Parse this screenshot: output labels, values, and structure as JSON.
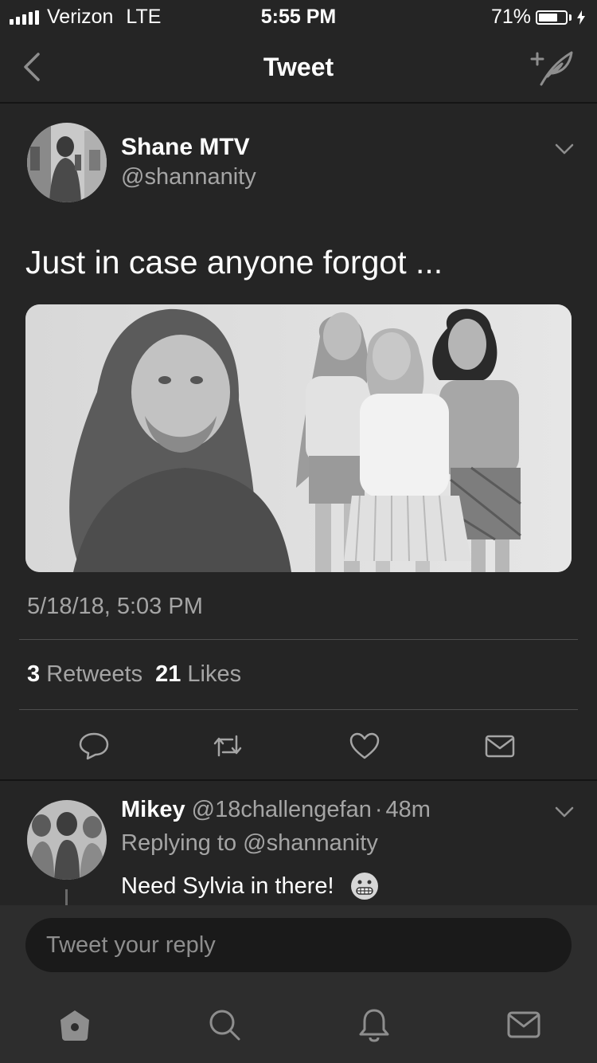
{
  "status_bar": {
    "carrier": "Verizon",
    "network": "LTE",
    "time": "5:55 PM",
    "battery_percent": "71%",
    "battery_level": 0.71,
    "charging_icon": "bolt-icon"
  },
  "nav": {
    "title": "Tweet",
    "back_icon": "chevron-left-icon",
    "compose_icon": "compose-tweet-icon"
  },
  "tweet": {
    "author_name": "Shane MTV",
    "author_handle": "@shannanity",
    "text": "Just in case anyone forgot ...",
    "timestamp": "5/18/18, 5:03 PM",
    "retweet_count": "3",
    "retweet_label": "Retweets",
    "like_count": "21",
    "like_label": "Likes",
    "actions": [
      "reply-icon",
      "retweet-icon",
      "like-icon",
      "share-icon"
    ]
  },
  "reply": {
    "author_name": "Mikey",
    "author_handle": "@18challengefan",
    "separator": "·",
    "age": "48m",
    "context": "Replying to @shannanity",
    "text": "Need Sylvia in there!"
  },
  "composer": {
    "placeholder": "Tweet your reply"
  },
  "tabs": [
    "home-icon",
    "search-icon",
    "notifications-icon",
    "messages-icon"
  ],
  "colors": {
    "background": "#252525",
    "secondary_text": "#a5a5a5",
    "bar_background": "#2d2d2d",
    "input_background": "#1a1a1a"
  }
}
